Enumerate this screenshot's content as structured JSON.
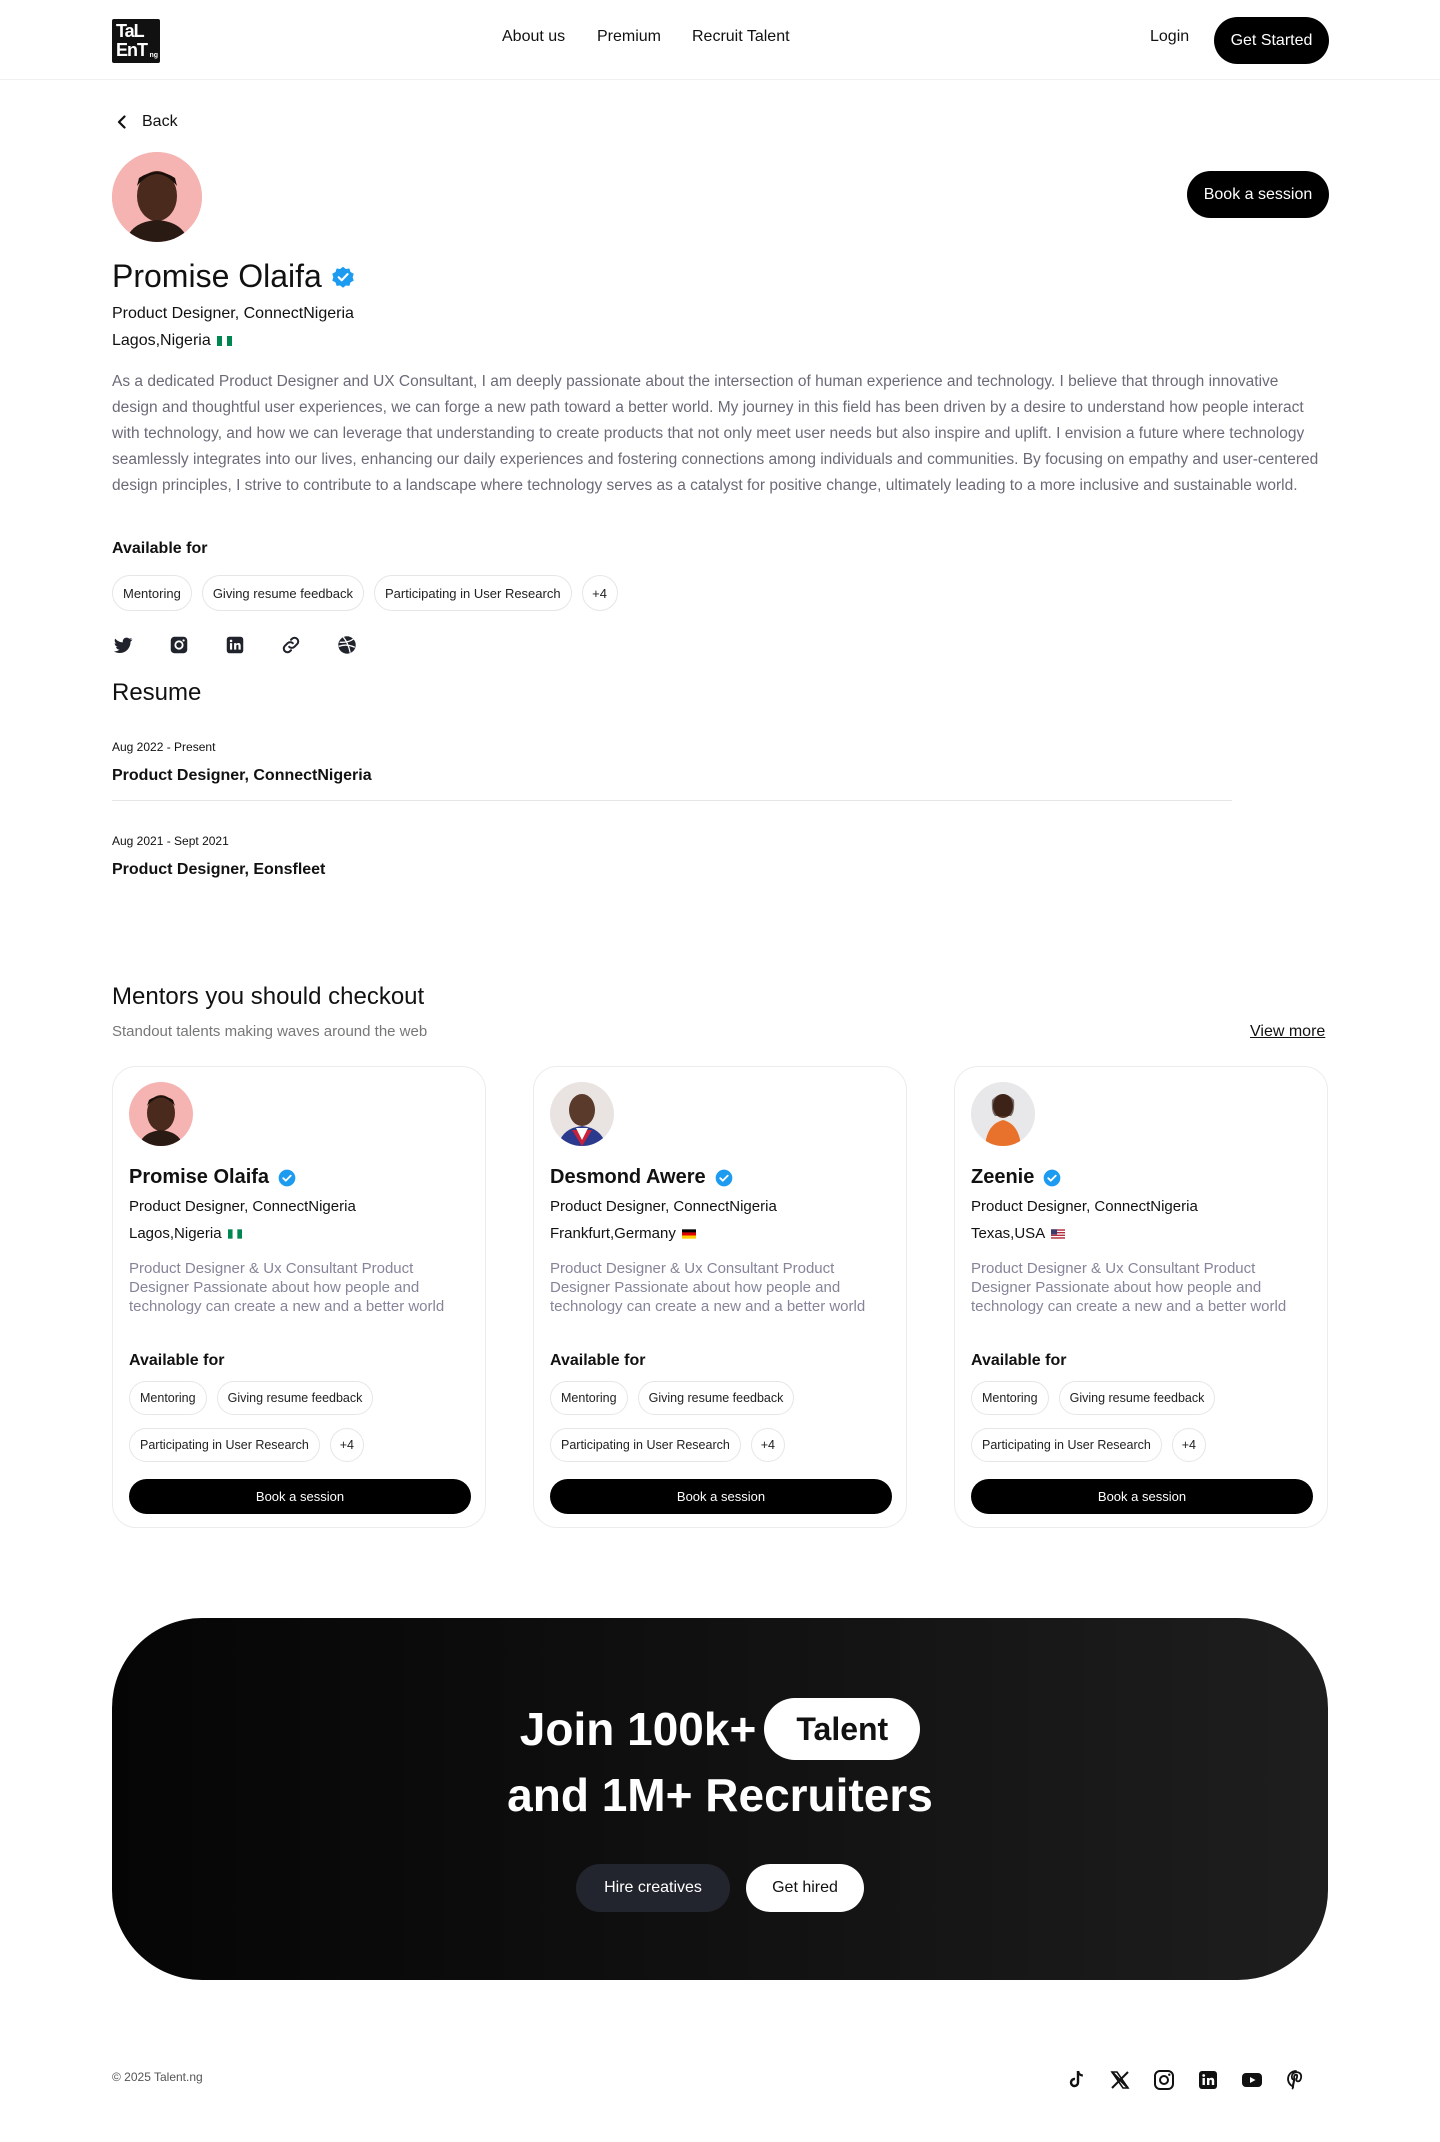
{
  "header": {
    "logo_line1": "TaL",
    "logo_line2": "EnT",
    "logo_suffix": "ng",
    "nav": [
      "About us",
      "Premium",
      "Recruit Talent"
    ],
    "login": "Login",
    "get_started": "Get Started"
  },
  "profile": {
    "back": "Back",
    "book_session": "Book a session",
    "name": "Promise Olaifa",
    "role": "Product Designer, ConnectNigeria",
    "location": "Lagos,Nigeria",
    "bio": "As a dedicated Product Designer and UX Consultant, I am deeply passionate about the intersection of human experience and technology. I believe that through innovative design and thoughtful user experiences, we can forge a new path toward a better world. My journey in this field has been driven by a desire to understand how people interact with technology, and how we can leverage that understanding to create products that not only meet user needs but also inspire and uplift. I envision a future where technology seamlessly integrates into our lives, enhancing our daily experiences and fostering connections among individuals and communities. By focusing on empathy and user-centered design principles, I strive to contribute to a landscape where technology serves as a catalyst for positive change, ultimately leading to a more inclusive and sustainable world.",
    "available_for_label": "Available for",
    "available_for": [
      "Mentoring",
      "Giving resume feedback",
      "Participating in User Research",
      "+4"
    ],
    "socials": [
      "twitter-icon",
      "instagram-icon",
      "linkedin-icon",
      "link-icon",
      "dribbble-icon"
    ]
  },
  "resume": {
    "title": "Resume",
    "entries": [
      {
        "date": "Aug 2022 - Present",
        "role": "Product Designer, ConnectNigeria"
      },
      {
        "date": "Aug 2021 - Sept 2021",
        "role": "Product Designer, Eonsfleet"
      }
    ]
  },
  "mentors": {
    "title": "Mentors you should checkout",
    "subtitle": "Standout talents making waves around the web",
    "view_more": "View more",
    "cards": [
      {
        "name": "Promise Olaifa",
        "role": "Product Designer, ConnectNigeria",
        "location": "Lagos,Nigeria",
        "bio": "Product Designer & Ux Consultant Product Designer Passionate about how people and technology can create a new and a better world",
        "available_for_label": "Available for",
        "tags": [
          "Mentoring",
          "Giving resume feedback",
          "Participating in User Research",
          "+4"
        ],
        "book": "Book a session"
      },
      {
        "name": "Desmond Awere",
        "role": "Product Designer, ConnectNigeria",
        "location": "Frankfurt,Germany",
        "bio": "Product Designer & Ux Consultant Product Designer Passionate about how people and technology can create a new and a better world",
        "available_for_label": "Available for",
        "tags": [
          "Mentoring",
          "Giving resume feedback",
          "Participating in User Research",
          "+4"
        ],
        "book": "Book a session"
      },
      {
        "name": "Zeenie",
        "role": "Product Designer, ConnectNigeria",
        "location": "Texas,USA",
        "bio": "Product Designer & Ux Consultant Product Designer Passionate about how people and technology can create a new and a better world",
        "available_for_label": "Available for",
        "tags": [
          "Mentoring",
          "Giving resume feedback",
          "Participating in User Research",
          "+4"
        ],
        "book": "Book a session"
      }
    ]
  },
  "cta": {
    "line1": "Join 100k+",
    "pill": "Talent",
    "line2": "and 1M+ Recruiters",
    "hire": "Hire creatives",
    "get_hired": "Get hired"
  },
  "footer": {
    "copyright": "© 2025 Talent.ng",
    "socials": [
      "tiktok-icon",
      "x-icon",
      "instagram-icon",
      "linkedin-icon",
      "youtube-icon",
      "pinterest-icon"
    ]
  },
  "colors": {
    "accent_verified": "#1d9bf0",
    "dark": "#000000",
    "muted_text": "#6b6b78"
  }
}
